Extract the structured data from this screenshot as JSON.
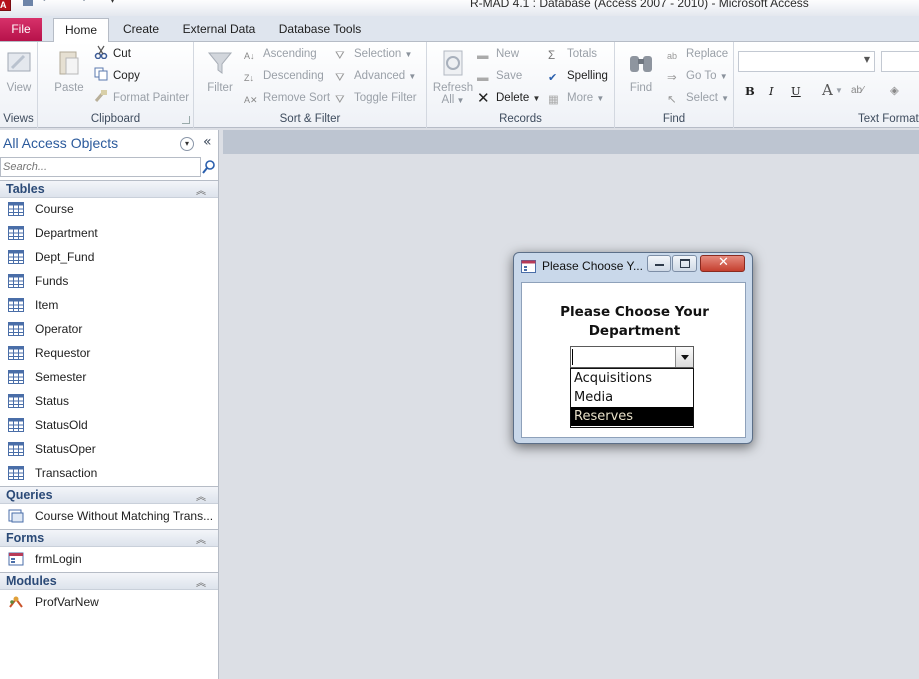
{
  "window": {
    "title": "R-MAD 4.1 : Database (Access 2007 - 2010)  -  Microsoft Access"
  },
  "tabs": [
    {
      "label": "File"
    },
    {
      "label": "Home"
    },
    {
      "label": "Create"
    },
    {
      "label": "External Data"
    },
    {
      "label": "Database Tools"
    }
  ],
  "ribbon": {
    "views": {
      "group": "Views",
      "view": "View"
    },
    "clipboard": {
      "group": "Clipboard",
      "paste": "Paste",
      "cut": "Cut",
      "copy": "Copy",
      "format_painter": "Format Painter"
    },
    "sort_filter": {
      "group": "Sort & Filter",
      "filter": "Filter",
      "ascending": "Ascending",
      "descending": "Descending",
      "remove_sort": "Remove Sort",
      "selection": "Selection",
      "advanced": "Advanced",
      "toggle_filter": "Toggle Filter"
    },
    "records": {
      "group": "Records",
      "refresh": "Refresh",
      "refresh_all": "All",
      "new": "New",
      "save": "Save",
      "delete": "Delete",
      "totals": "Totals",
      "spelling": "Spelling",
      "more": "More"
    },
    "find": {
      "group": "Find",
      "find": "Find",
      "replace": "Replace",
      "goto": "Go To",
      "select": "Select"
    },
    "text_formatting": {
      "group": "Text Formatting",
      "bold": "B",
      "italic": "I",
      "underline": "U",
      "font_color": "A"
    }
  },
  "nav": {
    "title": "All Access Objects",
    "search_placeholder": "Search...",
    "sections": {
      "tables": {
        "label": "Tables",
        "items": [
          "Course",
          "Department",
          "Dept_Fund",
          "Funds",
          "Item",
          "Operator",
          "Requestor",
          "Semester",
          "Status",
          "StatusOld",
          "StatusOper",
          "Transaction"
        ]
      },
      "queries": {
        "label": "Queries",
        "items": [
          "Course Without Matching Trans..."
        ]
      },
      "forms": {
        "label": "Forms",
        "items": [
          "frmLogin"
        ]
      },
      "modules": {
        "label": "Modules",
        "items": [
          "ProfVarNew"
        ]
      }
    }
  },
  "dialog": {
    "title": "Please Choose Y...",
    "heading": "Please Choose Your Department",
    "combo_value": "",
    "options": [
      "Acquisitions",
      "Media",
      "Reserves"
    ],
    "selected_option": "Reserves"
  },
  "colors": {
    "file_tab": "#c4185a",
    "accent_text": "#2b5a9c",
    "selection": "#000000"
  }
}
